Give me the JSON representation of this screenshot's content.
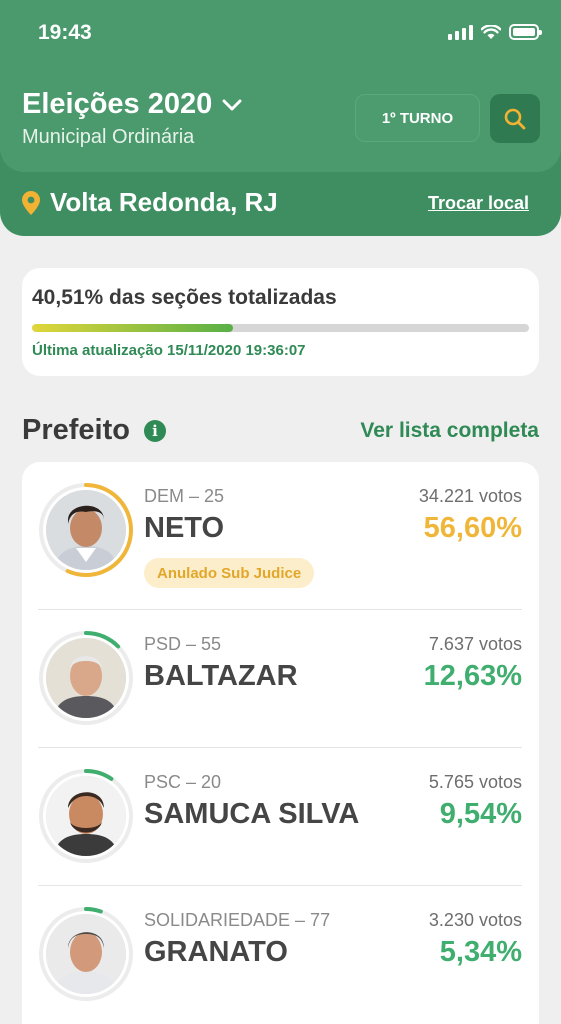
{
  "status_bar": {
    "time": "19:43"
  },
  "header": {
    "title": "Eleições 2020",
    "subtitle": "Municipal Ordinária",
    "turno_label": "1º TURNO",
    "location": "Volta Redonda, RJ",
    "change_location": "Trocar local"
  },
  "progress": {
    "title": "40,51% das seções totalizadas",
    "fraction": 0.4051,
    "updated": "Última atualização 15/11/2020 19:36:07"
  },
  "section": {
    "title": "Prefeito",
    "see_all": "Ver lista completa"
  },
  "candidates": [
    {
      "party": "DEM – 25",
      "name": "NETO",
      "votes": "34.221 votos",
      "percent": "56,60%",
      "share": 0.566,
      "color": "#f0b63a",
      "badge": "Anulado Sub Judice"
    },
    {
      "party": "PSD – 55",
      "name": "BALTAZAR",
      "votes": "7.637 votos",
      "percent": "12,63%",
      "share": 0.1263,
      "color": "#3fae6e"
    },
    {
      "party": "PSC – 20",
      "name": "SAMUCA SILVA",
      "votes": "5.765 votos",
      "percent": "9,54%",
      "share": 0.0954,
      "color": "#3fae6e"
    },
    {
      "party": "SOLIDARIEDADE – 77",
      "name": "GRANATO",
      "votes": "3.230 votos",
      "percent": "5,34%",
      "share": 0.0534,
      "color": "#3fae6e"
    }
  ],
  "colors": {
    "brand_green": "#4a9a6d",
    "accent_green": "#2f8a55",
    "annulled": "#f0b63a",
    "pin": "#f2b233"
  }
}
